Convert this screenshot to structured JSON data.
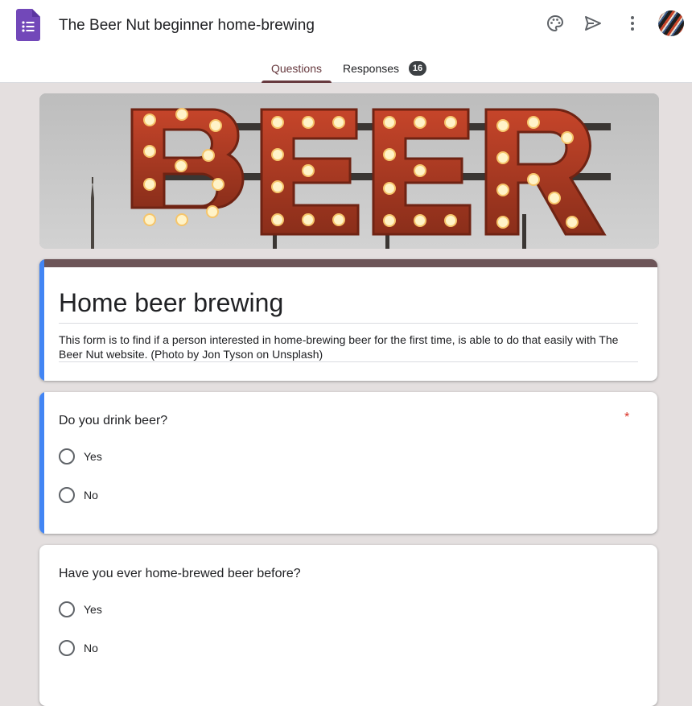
{
  "header": {
    "doc_title": "The Beer Nut beginner home-brewing",
    "icons": [
      "forms-app-icon",
      "palette-icon",
      "send-icon",
      "more-vert-icon",
      "avatar"
    ]
  },
  "tabs": {
    "questions_label": "Questions",
    "responses_label": "Responses",
    "responses_count": "16"
  },
  "banner": {
    "sign_text": "BEER"
  },
  "form": {
    "title": "Home beer brewing",
    "description": "This form is to find if a person interested in home-brewing beer for the first time, is able to do that easily with The Beer Nut website. (Photo by Jon Tyson on Unsplash)"
  },
  "questions": [
    {
      "text": "Do you drink beer?",
      "required_mark": "*",
      "options": [
        "Yes",
        "No"
      ]
    },
    {
      "text": "Have you ever home-brewed beer before?",
      "options": [
        "Yes",
        "No"
      ]
    }
  ],
  "colors": {
    "accent": "#673a3f",
    "focus_bar": "#4285f4",
    "background": "#e4dfdf",
    "title_strip": "#6d5558",
    "required": "#d93025"
  }
}
